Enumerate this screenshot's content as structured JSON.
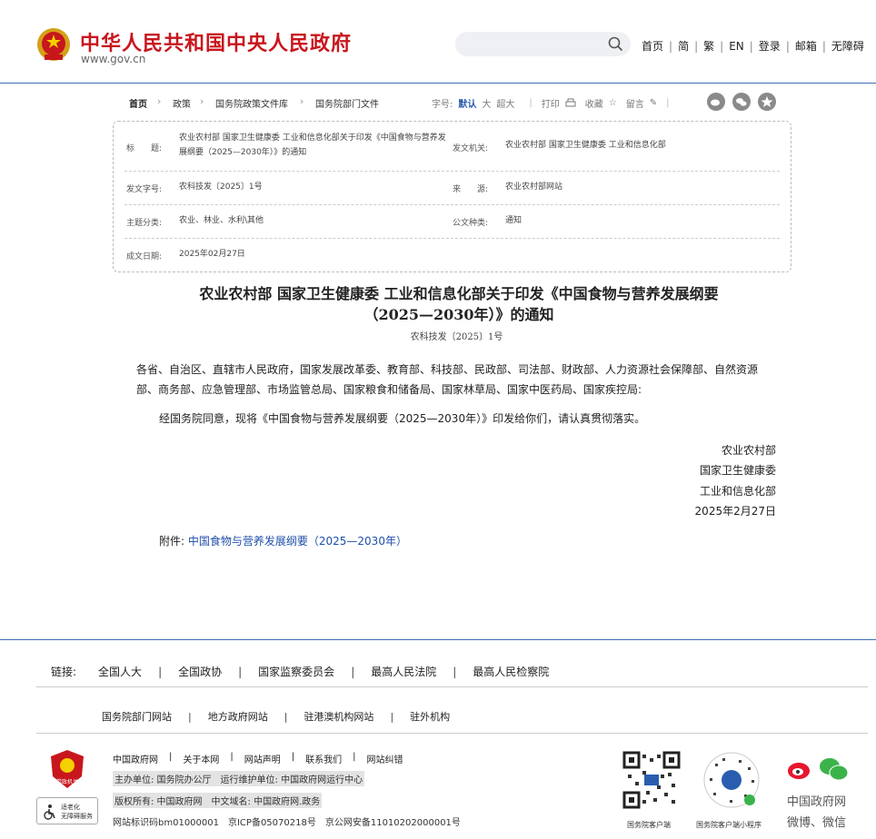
{
  "header": {
    "site_title": "中华人民共和国中央人民政府",
    "site_url": "www.gov.cn",
    "nav": [
      "首页",
      "简",
      "繁",
      "EN",
      "登录",
      "邮箱",
      "无障碍"
    ]
  },
  "breadcrumb": [
    "首页",
    "政策",
    "国务院政策文件库",
    "国务院部门文件"
  ],
  "tools": {
    "font_label": "字号:",
    "font_default": "默认",
    "font_large": "大",
    "font_xlarge": "超大",
    "print": "打印",
    "favorite": "收藏",
    "comment": "留言"
  },
  "info": {
    "title_label": "标　　题:",
    "title_value": "农业农村部 国家卫生健康委 工业和信息化部关于印发《中国食物与营养发展纲要（2025—2030年）》的通知",
    "issuer_label": "发文机关:",
    "issuer_value": "农业农村部 国家卫生健康委 工业和信息化部",
    "doc_no_label": "发文字号:",
    "doc_no_value": "农科技发〔2025〕1号",
    "source_label": "来　　源:",
    "source_value": "农业农村部网站",
    "topic_label": "主题分类:",
    "topic_value": "农业、林业、水利\\其他",
    "type_label": "公文种类:",
    "type_value": "通知",
    "date_label": "成文日期:",
    "date_value": "2025年02月27日"
  },
  "doc": {
    "title_line1": "农业农村部 国家卫生健康委 工业和信息化部关于印发《中国食物与营养发展纲要",
    "title_line2": "（2025—2030年）》的通知",
    "number": "农科技发〔2025〕1号",
    "recipients": "各省、自治区、直辖市人民政府，国家发展改革委、教育部、科技部、民政部、司法部、财政部、人力资源社会保障部、自然资源部、商务部、应急管理部、市场监管总局、国家粮食和储备局、国家林草局、国家中医药局、国家疾控局:",
    "body": "经国务院同意，现将《中国食物与营养发展纲要（2025—2030年）》印发给你们，请认真贯彻落实。",
    "signers": [
      "农业农村部",
      "国家卫生健康委",
      "工业和信息化部"
    ],
    "sign_date": "2025年2月27日",
    "attachment_label": "附件:",
    "attachment_link": "中国食物与营养发展纲要（2025—2030年）"
  },
  "footer": {
    "links_label": "链接:",
    "links_row1": [
      "全国人大",
      "全国政协",
      "国家监察委员会",
      "最高人民法院",
      "最高人民检察院"
    ],
    "links_row2": [
      "国务院部门网站",
      "地方政府网站",
      "驻港澳机构网站",
      "驻外机构"
    ],
    "site_links": [
      "中国政府网",
      "关于本网",
      "网站声明",
      "联系我们",
      "网站纠错"
    ],
    "sponsor": "主办单位: 国务院办公厅　运行维护单位: 中国政府网运行中心",
    "copyright": "版权所有: 中国政府网　中文域名: 中国政府网.政务",
    "icp": "网站标识码bm01000001　京ICP备05070218号　京公网安备11010202000001号",
    "emblem_text": "党政机关",
    "access_text1": "适老化",
    "access_text2": "无障碍服务",
    "qr1_caption": "国务院客户端",
    "qr2_caption": "国务院客户端小程序",
    "social_line1": "中国政府网",
    "social_line2": "微博、微信"
  }
}
